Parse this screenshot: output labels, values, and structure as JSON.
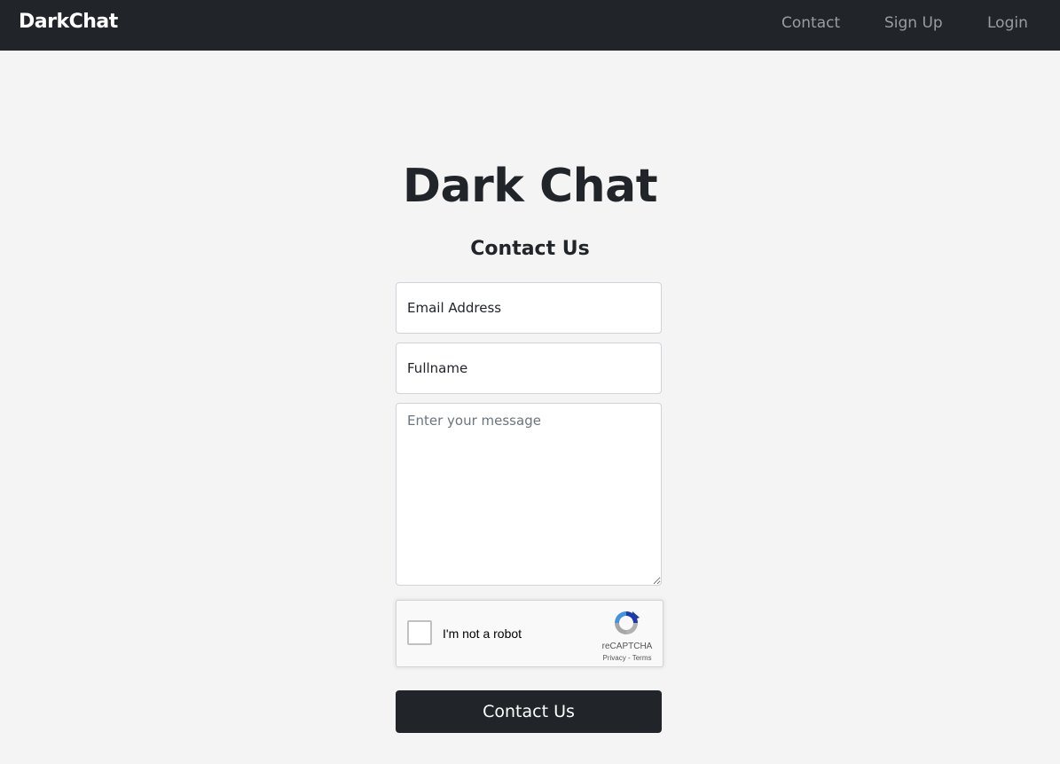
{
  "navbar": {
    "brand": "DarkChat",
    "links": [
      {
        "label": "Contact"
      },
      {
        "label": "Sign Up"
      },
      {
        "label": "Login"
      }
    ]
  },
  "main": {
    "title": "Dark Chat",
    "subtitle": "Contact Us"
  },
  "form": {
    "email_placeholder": "Email Address",
    "fullname_placeholder": "Fullname",
    "message_placeholder": "Enter your message",
    "recaptcha": {
      "label": "I'm not a robot",
      "brand": "reCAPTCHA",
      "privacy": "Privacy",
      "separator": " - ",
      "terms": "Terms",
      "checked": false
    },
    "submit_label": "Contact Us"
  },
  "colors": {
    "navbar_bg": "#212529",
    "page_bg": "#f4f4f4",
    "button_bg": "#212529"
  }
}
